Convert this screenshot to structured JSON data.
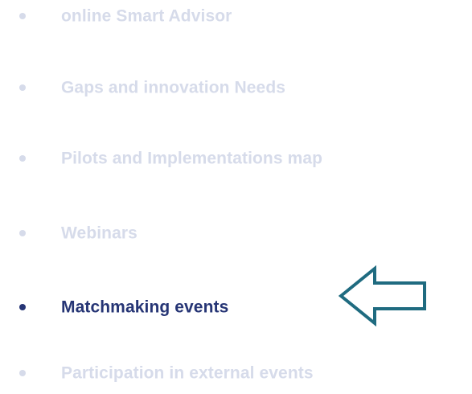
{
  "menu": {
    "items": [
      {
        "label": "online Smart Advisor",
        "state": "muted"
      },
      {
        "label": "Gaps and innovation Needs",
        "state": "muted"
      },
      {
        "label": "Pilots and Implementations map",
        "state": "muted"
      },
      {
        "label": "Webinars",
        "state": "muted"
      },
      {
        "label": "Matchmaking events",
        "state": "active"
      },
      {
        "label": "Participation in external events",
        "state": "muted"
      }
    ]
  },
  "pointer": {
    "icon": "left-arrow-outline-icon"
  },
  "colors": {
    "active_text": "#263575",
    "muted_text": "#d6dbea",
    "arrow_stroke": "#1f6b80"
  }
}
